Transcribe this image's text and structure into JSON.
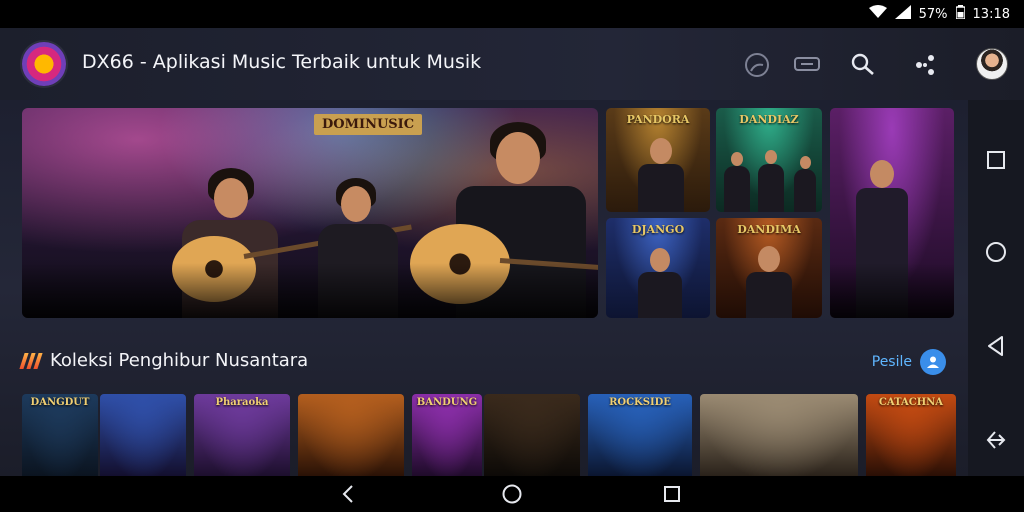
{
  "status_bar": {
    "battery": "57%",
    "time": "13:18"
  },
  "app_bar": {
    "title": "DX66 - Aplikasi Music Terbaik untuk Musik",
    "logo_label": "DX66",
    "actions": [
      "cast-icon",
      "subtitles-icon",
      "search-icon",
      "share-icon"
    ]
  },
  "hero": {
    "badge_text": "DOMINUSIC"
  },
  "featured_tiles": [
    {
      "title": "PANDORA",
      "gradient": [
        "#5a3b18",
        "#b58230",
        "#2b1a0b"
      ]
    },
    {
      "title": "DANDIAZ",
      "gradient": [
        "#1a5c4a",
        "#2fae8a",
        "#0c2a22"
      ]
    },
    {
      "title": "",
      "gradient": [
        "#5b1f66",
        "#9a3bb6",
        "#1c0b24"
      ]
    },
    {
      "title": "DJANGO",
      "gradient": [
        "#1e2e6a",
        "#3c62c0",
        "#0d1431"
      ]
    },
    {
      "title": "DANDIMA",
      "gradient": [
        "#5a2a12",
        "#b45a22",
        "#1f0c05"
      ]
    }
  ],
  "section": {
    "title": "Koleksi Penghibur Nusantara",
    "more_label": "Pesile"
  },
  "albums": [
    {
      "title": "DANGDUT",
      "colors": [
        "#1d3a5c",
        "#0b1420"
      ]
    },
    {
      "title": "",
      "colors": [
        "#2f4fa8",
        "#130f2e"
      ]
    },
    {
      "title": "Pharaoka",
      "colors": [
        "#6d3a9b",
        "#1d0f2d"
      ]
    },
    {
      "title": "",
      "colors": [
        "#b35e1e",
        "#2a1206"
      ]
    },
    {
      "title": "BANDUNG",
      "colors": [
        "#8a2ea8",
        "#1f0b2a"
      ]
    },
    {
      "title": "",
      "colors": [
        "#3a2a1c",
        "#0d0a07"
      ]
    },
    {
      "title": "ROCKSIDE",
      "colors": [
        "#2760b8",
        "#0b1630"
      ]
    },
    {
      "title": "",
      "colors": [
        "#9a8a72",
        "#2a221a"
      ]
    },
    {
      "title": "CATACHNA",
      "colors": [
        "#c24a12",
        "#2a0f05"
      ]
    }
  ],
  "side_nav": [
    "square-icon",
    "circle-icon",
    "back-triangle-icon",
    "share-arrow-icon"
  ],
  "system_nav": [
    "back-icon",
    "home-icon",
    "recents-icon"
  ],
  "colors": {
    "accent": "#3a8eea",
    "section_bars": "#f0502c",
    "background": "#12141c"
  }
}
